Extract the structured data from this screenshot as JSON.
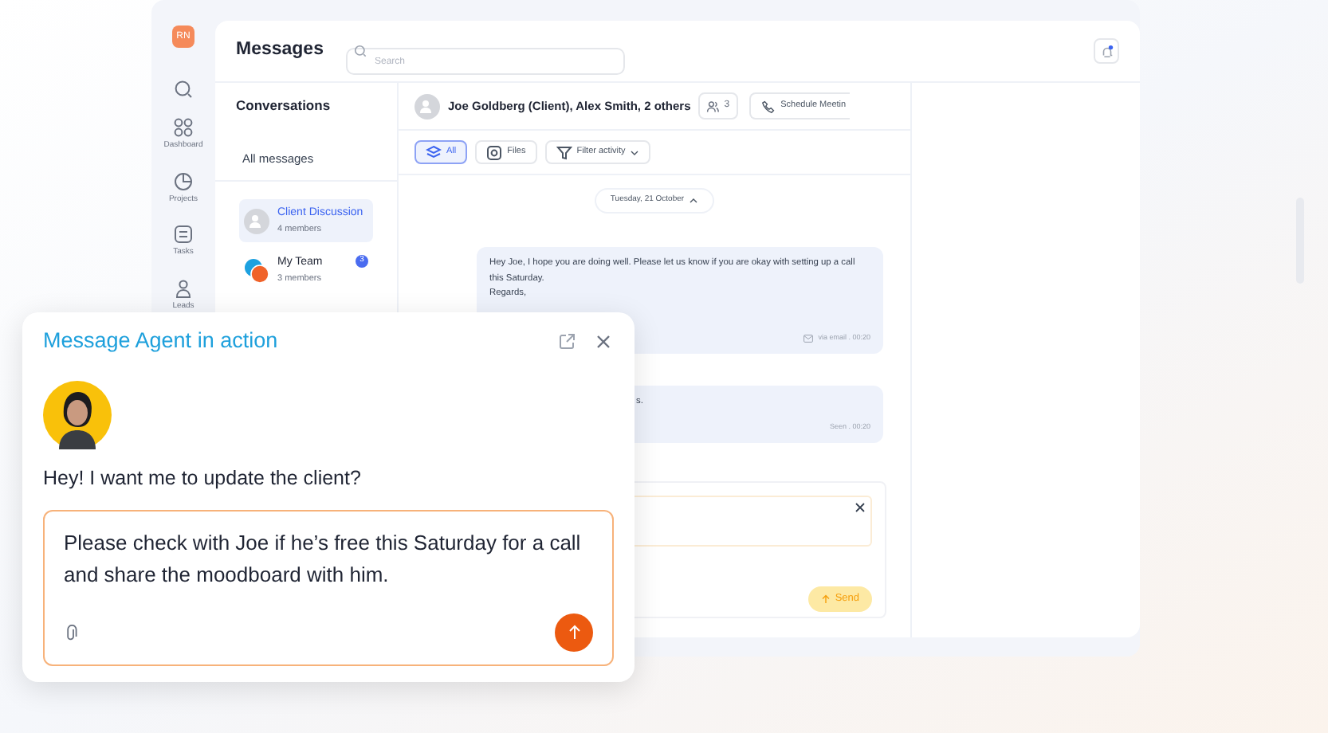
{
  "sidebar": {
    "logo": "RN",
    "items": [
      {
        "label": "Dashboard",
        "kind": "dashboard"
      },
      {
        "label": "Projects",
        "kind": "projects"
      },
      {
        "label": "Tasks",
        "kind": "tasks"
      },
      {
        "label": "Leads",
        "kind": "leads"
      }
    ]
  },
  "header": {
    "title": "Messages",
    "search": {
      "placeholder": "Search"
    }
  },
  "conversations": {
    "title": "Conversations",
    "filter": "All messages",
    "items": [
      {
        "name": "Client Discussion",
        "members": "4 members",
        "selected": true,
        "kind": "group"
      },
      {
        "name": "My Team",
        "members": "3 members",
        "selected": false,
        "kind": "team",
        "badge": "3"
      }
    ]
  },
  "chat": {
    "title": "Joe Goldberg (Client), Alex Smith, 2 others",
    "participants": "3",
    "schedule": "Schedule Meetin",
    "filters": [
      {
        "label": "All",
        "selected": true,
        "kind": "all"
      },
      {
        "label": "Files",
        "selected": false,
        "kind": "files"
      },
      {
        "label": "Filter activity",
        "selected": false,
        "kind": "dropdown"
      }
    ],
    "date": "Tuesday, 21 October",
    "messages": [
      {
        "text": "Hey Joe, I hope you are doing well. Please let us know if you are okay with setting up a call this Saturday.\nRegards,",
        "meta": "via email . 00:20",
        "kind": "email"
      },
      {
        "text": "s.",
        "meta": "Seen . 00:20",
        "kind": "seen"
      }
    ],
    "send": "Send"
  },
  "agent": {
    "title": "Message Agent in action",
    "prompt": "Hey! I want me to update the client?",
    "value": "Please check with Joe if he’s free this Saturday for a call and share the moodboard with him."
  }
}
